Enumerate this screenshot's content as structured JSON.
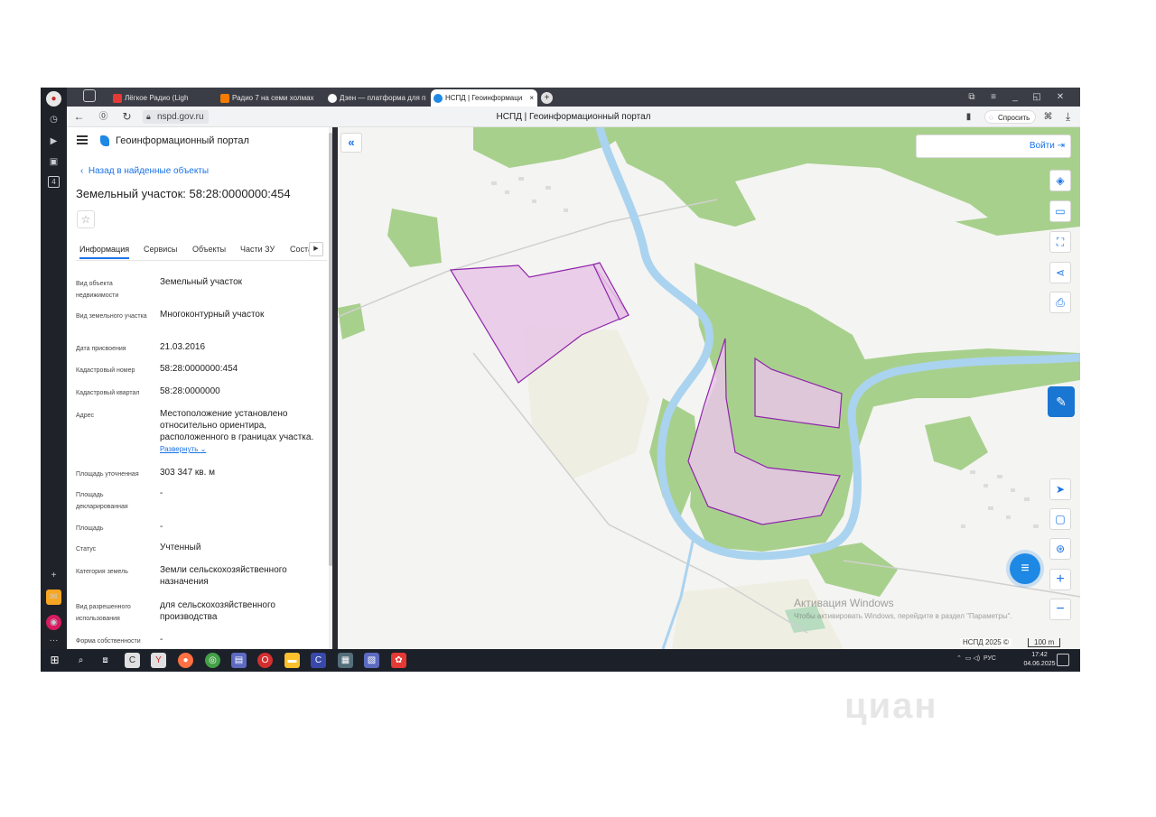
{
  "browser": {
    "tabs": [
      {
        "label": "Лёгкое Радио (Ligh",
        "color": "#e53935"
      },
      {
        "label": "Радио 7 на семи холмах",
        "color": "#f57c00"
      },
      {
        "label": "Дзен — платформа для п",
        "color": "#222222"
      },
      {
        "label": "НСПД | Геоинформаци",
        "color": "#1e88e5",
        "active": true
      }
    ],
    "url": "nspd.gov.ru",
    "page_title": "НСПД | Геоинформационный портал",
    "ask_label": "Спросить"
  },
  "sidebar": {
    "portal_name": "Геоинформационный портал",
    "back_label": "Назад в найденные объекты",
    "title": "Земельный участок: 58:28:0000000:454",
    "tabs": [
      "Информация",
      "Сервисы",
      "Объекты",
      "Части ЗУ",
      "Соста"
    ],
    "fields": [
      {
        "label": "Вид объекта недвижимости",
        "value": "Земельный участок"
      },
      {
        "label": "Вид земельного участка",
        "value": "Многоконтурный участок"
      },
      {
        "label": "Дата присвоения",
        "value": "21.03.2016"
      },
      {
        "label": "Кадастровый номер",
        "value": "58:28:0000000:454"
      },
      {
        "label": "Кадастровый квартал",
        "value": "58:28:0000000"
      },
      {
        "label": "Адрес",
        "value": "Местоположение установлено относительно ориентира, расположенного в границах участка.",
        "link": "Развернуть"
      },
      {
        "label": "Площадь уточненная",
        "value": "303 347 кв. м"
      },
      {
        "label": "Площадь декларированная",
        "value": "-"
      },
      {
        "label": "Площадь",
        "value": "-"
      },
      {
        "label": "Статус",
        "value": "Учтенный"
      },
      {
        "label": "Категория земель",
        "value": "Земли сельскохозяйственного назначения"
      },
      {
        "label": "Вид разрешенного использования",
        "value": "для сельскохозяйственного производства"
      },
      {
        "label": "Форма собственности",
        "value": "-"
      }
    ]
  },
  "map": {
    "login_label": "Войти",
    "copyright": "НСПД 2025 ©",
    "scale": "100 m",
    "watermark_title": "Активация Windows",
    "watermark_text": "Чтобы активировать Windows, перейдите в раздел \"Параметры\".",
    "colors": {
      "forest": "#a8d08d",
      "river": "#aad3ef",
      "parcel_fill": "#e7c6e6",
      "parcel_stroke": "#8e24aa",
      "field": "#efeee2"
    }
  },
  "taskbar": {
    "lang": "РУС",
    "time": "17:42",
    "date": "04.06.2025"
  },
  "watermark_brand": "циан"
}
